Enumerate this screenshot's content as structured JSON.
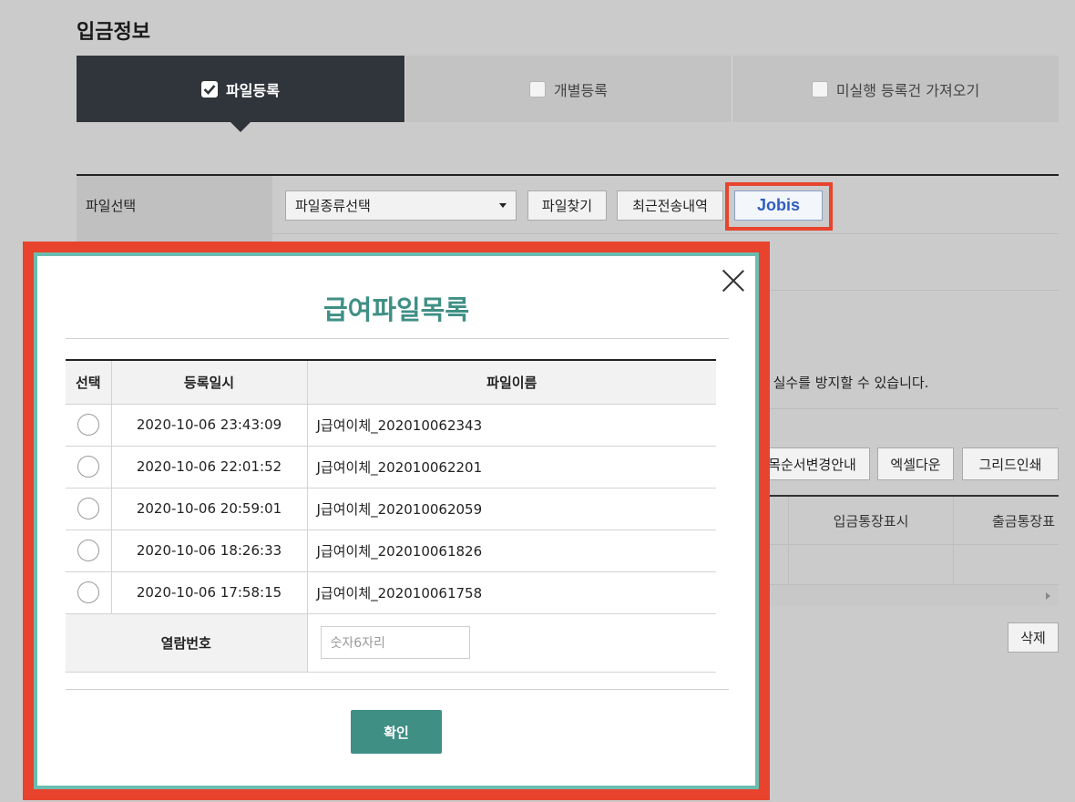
{
  "section_title": "입금정보",
  "tabs": [
    {
      "label": "파일등록",
      "checked": true
    },
    {
      "label": "개별등록",
      "checked": false
    },
    {
      "label": "미실행 등록건 가져오기",
      "checked": false
    }
  ],
  "form": {
    "file_select_label": "파일선택",
    "file_type_select": "파일종류선택",
    "find_file_button": "파일찾기",
    "recent_history_button": "최근전송내역",
    "jobis_button": "Jobis",
    "info_text": "른 실수를 방지할 수 있습니다."
  },
  "grid": {
    "buttons": [
      "목순서변경안내",
      "엑셀다운",
      "그리드인쇄"
    ],
    "headers": [
      "입금통장표시",
      "출금통장표"
    ],
    "delete_button": "삭제"
  },
  "modal": {
    "title": "급여파일목록",
    "columns": [
      "선택",
      "등록일시",
      "파일이름"
    ],
    "rows": [
      {
        "date": "2020-10-06 23:43:09",
        "filename": "J급여이체_202010062343"
      },
      {
        "date": "2020-10-06 22:01:52",
        "filename": "J급여이체_202010062201"
      },
      {
        "date": "2020-10-06 20:59:01",
        "filename": "J급여이체_202010062059"
      },
      {
        "date": "2020-10-06 18:26:33",
        "filename": "J급여이체_202010061826"
      },
      {
        "date": "2020-10-06 17:58:15",
        "filename": "J급여이체_202010061758"
      }
    ],
    "password_label": "열람번호",
    "password_placeholder": "숫자6자리",
    "confirm_button": "확인"
  },
  "colors": {
    "highlight": "#e8432d",
    "modal_accent": "#3f8f85",
    "modal_border": "#6bbdb0",
    "active_tab": "#30343b",
    "jobis_text": "#2f5ec2"
  }
}
